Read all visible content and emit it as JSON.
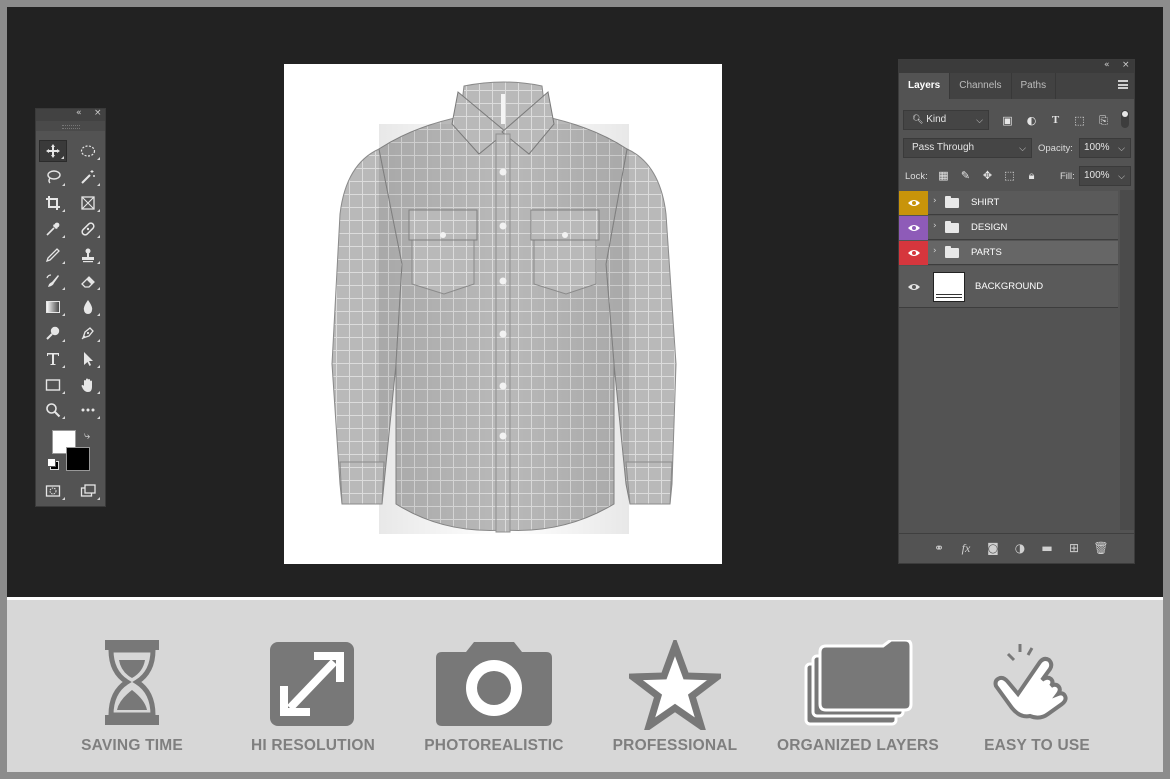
{
  "toolbox": {
    "collapse_icon": "double-chevron-left-icon",
    "close_icon": "close-icon"
  },
  "layers_panel": {
    "tabs": [
      {
        "label": "Layers",
        "active": true
      },
      {
        "label": "Channels",
        "active": false
      },
      {
        "label": "Paths",
        "active": false
      }
    ],
    "filter": {
      "label": "Kind"
    },
    "blend_mode": "Pass Through",
    "opacity": {
      "label": "Opacity:",
      "value": "100%"
    },
    "lock": {
      "label": "Lock:"
    },
    "fill": {
      "label": "Fill:",
      "value": "100%"
    },
    "layers": [
      {
        "name": "SHIRT",
        "color": "#c8940a",
        "type": "group"
      },
      {
        "name": "DESIGN",
        "color": "#8e5bb8",
        "type": "group"
      },
      {
        "name": "PARTS",
        "color": "#d6363d",
        "type": "group"
      },
      {
        "name": "BACKGROUND",
        "color": "",
        "type": "pixel"
      }
    ]
  },
  "features": [
    {
      "label": "SAVING TIME",
      "icon": "hourglass-icon"
    },
    {
      "label": "HI RESOLUTION",
      "icon": "expand-arrows-icon"
    },
    {
      "label": "PHOTOREALISTIC",
      "icon": "camera-icon"
    },
    {
      "label": "PROFESSIONAL",
      "icon": "star-icon"
    },
    {
      "label": "ORGANIZED LAYERS",
      "icon": "folders-icon"
    },
    {
      "label": "EASY TO USE",
      "icon": "tap-hand-icon"
    }
  ],
  "colors": {
    "workspace": "#222222",
    "panel": "#535353",
    "feature_icon": "#787878",
    "feature_text": "#7f7f7f"
  }
}
